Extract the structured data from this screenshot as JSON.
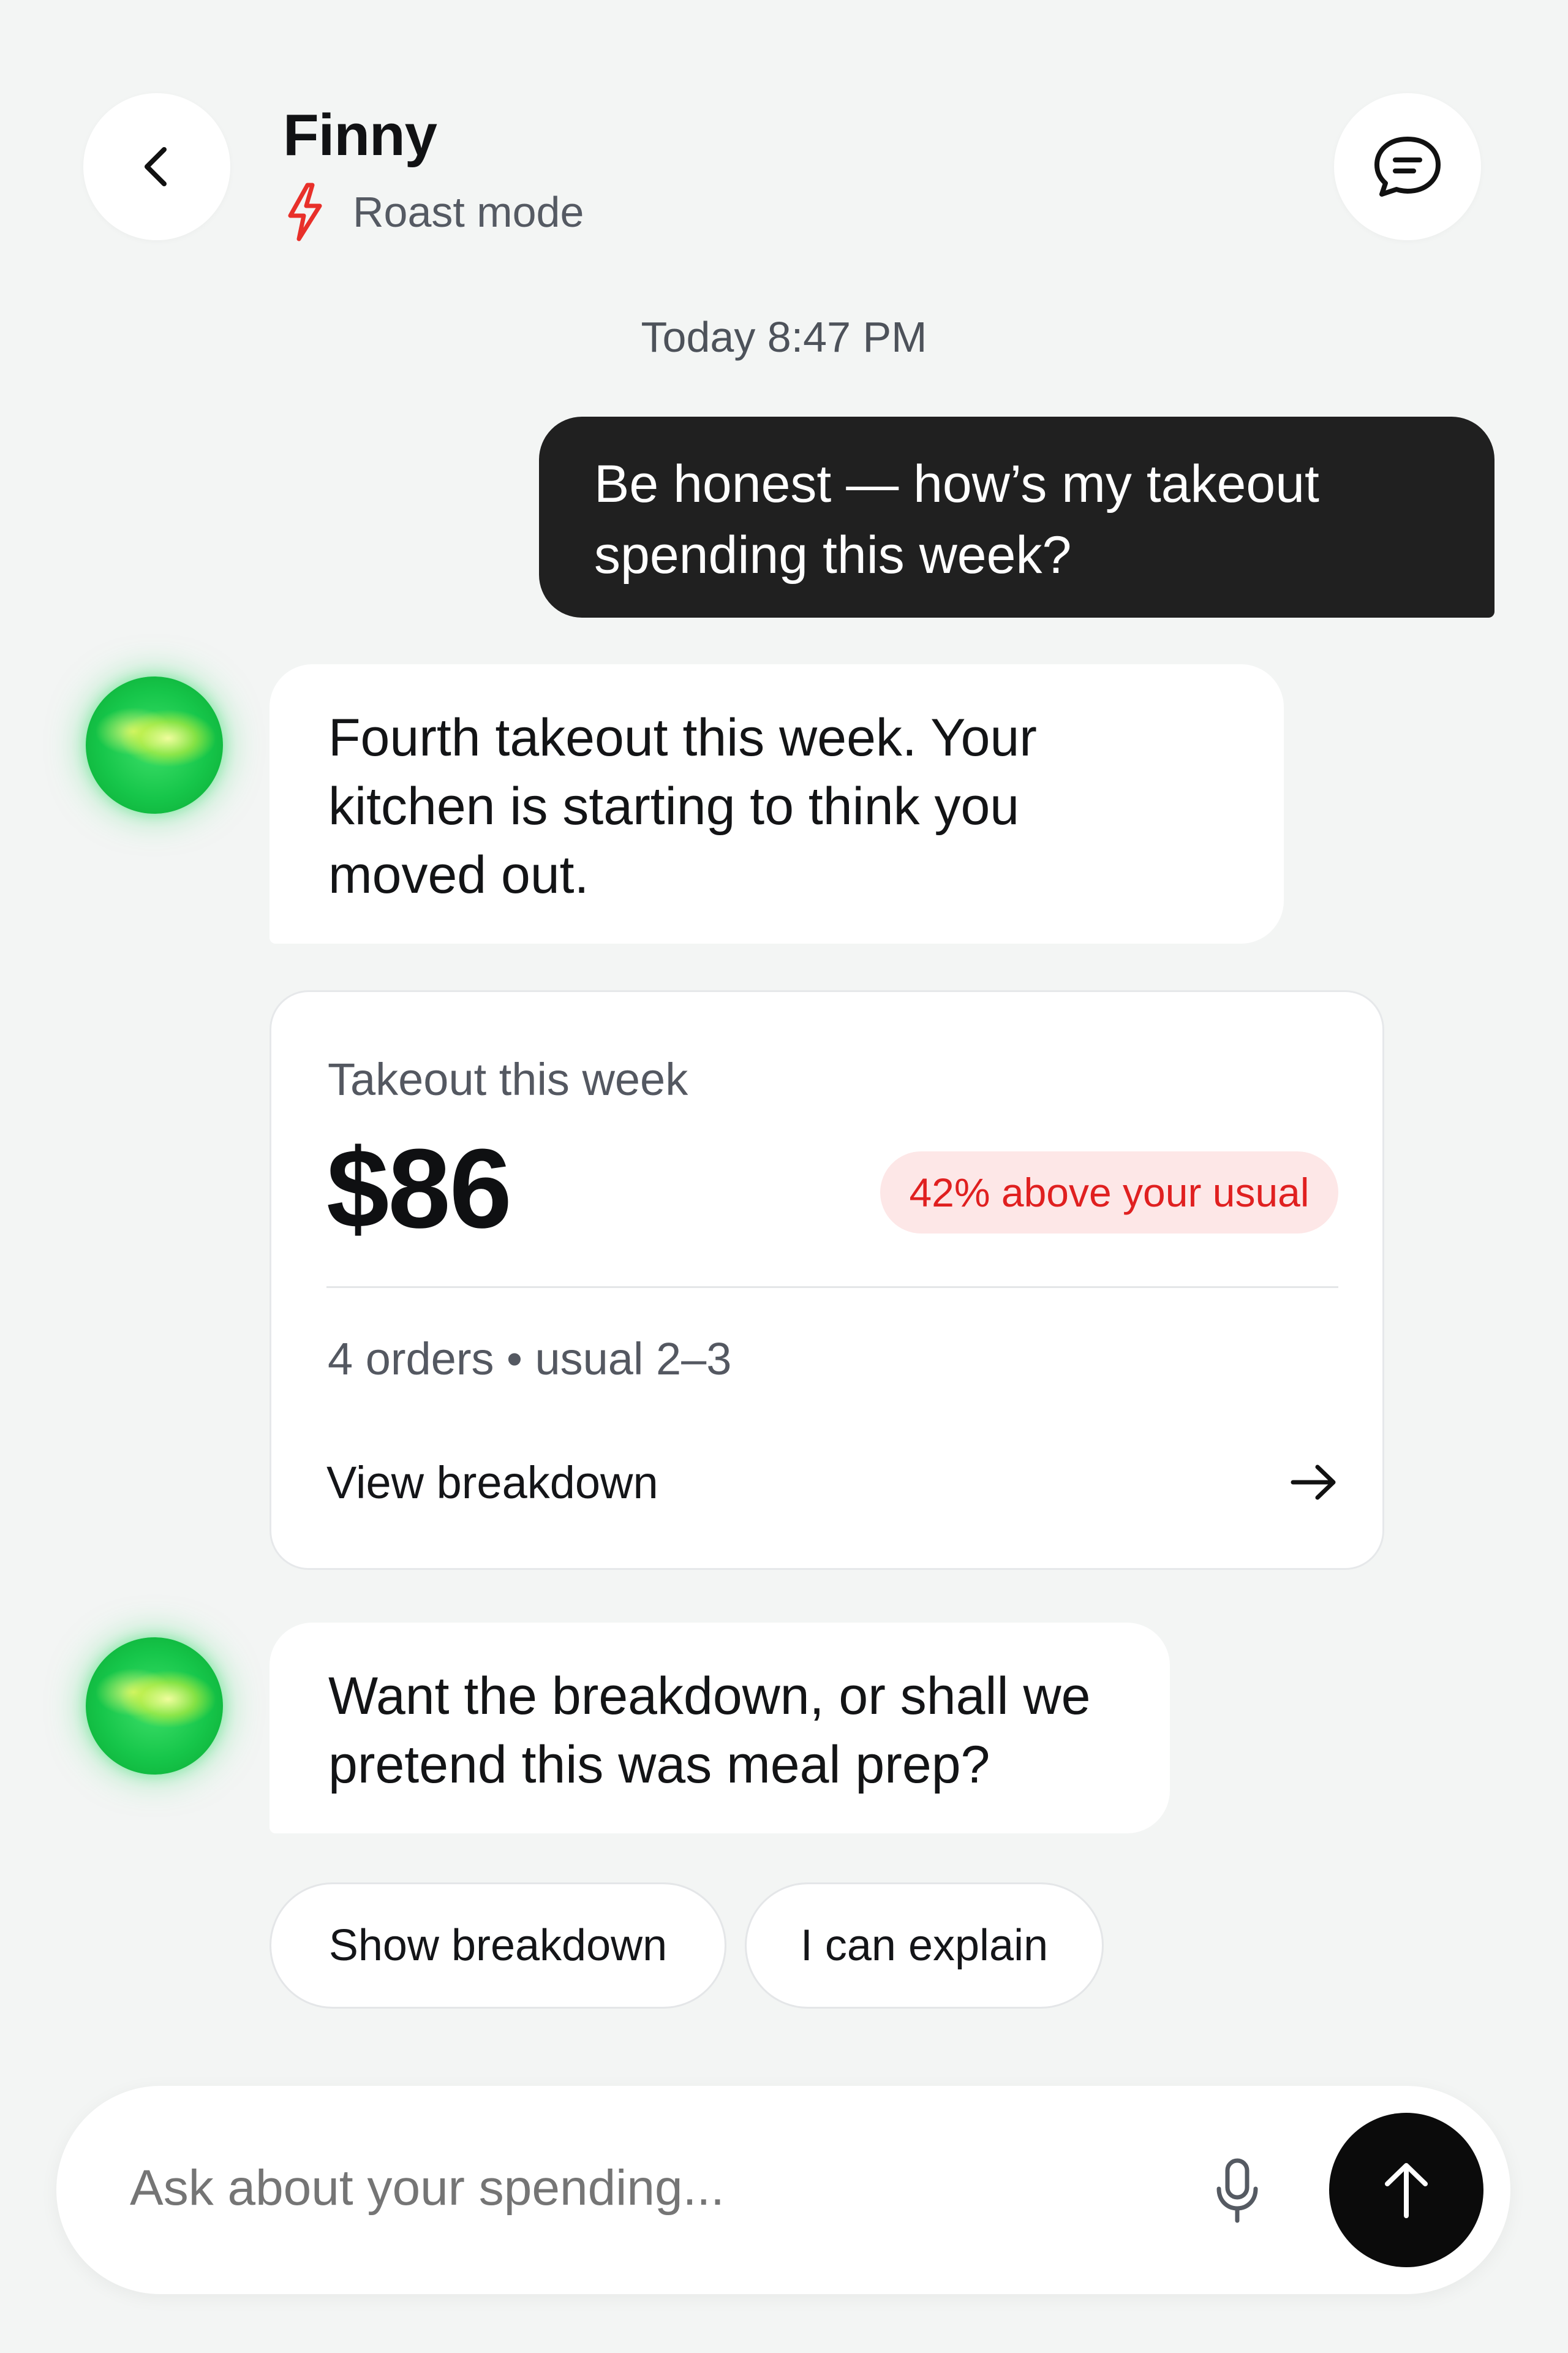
{
  "header": {
    "title": "Finny",
    "mode_label": "Roast mode",
    "back_icon": "chevron-left-icon",
    "chat_icon": "chat-bubble-icon",
    "mode_icon": "lightning-bolt-icon",
    "mode_icon_color": "#e8302a"
  },
  "timestamp": "Today 8:47 PM",
  "messages": [
    {
      "role": "user",
      "lines": [
        "Be honest — how’s my takeout",
        "spending this week?"
      ]
    },
    {
      "role": "assistant",
      "lines": [
        "Fourth takeout this week. Your",
        "kitchen is starting to think you",
        "moved out."
      ]
    },
    {
      "role": "assistant",
      "lines": [
        "Want the breakdown, or shall we",
        "pretend this was meal prep?"
      ]
    }
  ],
  "spending_card": {
    "label": "Takeout this week",
    "amount": "$86",
    "badge": "42% above your usual",
    "badge_color": "#e02020",
    "meta": "4 orders • usual 2–3",
    "link": "View breakdown",
    "link_icon": "arrow-right-icon"
  },
  "quick_replies": [
    "Show breakdown",
    "I can explain"
  ],
  "composer": {
    "placeholder": "Ask about your spending...",
    "mic_icon": "microphone-icon",
    "send_icon": "arrow-up-icon"
  }
}
